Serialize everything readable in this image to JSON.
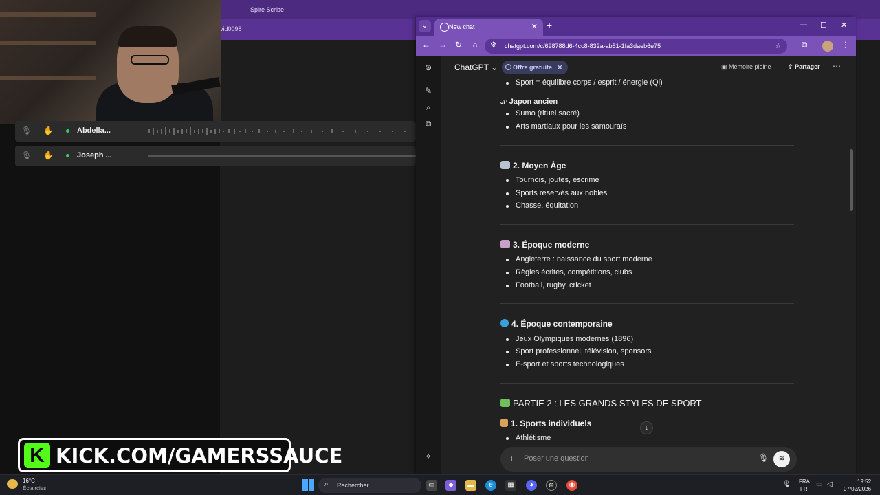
{
  "background_app": {
    "tab_title": "Spire Scribe",
    "url_fragment": "vid0098"
  },
  "voice_chat": {
    "participants": [
      {
        "name": "Abdella..."
      },
      {
        "name": "Joseph ..."
      }
    ]
  },
  "overlay": {
    "kick_logo": "K",
    "kick_text": "KICK.COM/GAMERSSAUCE"
  },
  "browser": {
    "tab_title": "New chat",
    "url": "chatgpt.com/c/698788d6-4cc8-832a-ab51-1fa3daeb6e75"
  },
  "chatgpt": {
    "model": "ChatGPT",
    "offer": "Offre gratuite",
    "memory": "Mémoire pleine",
    "share": "Partager",
    "composer_placeholder": "Poser une question"
  },
  "conversation": {
    "top_bullet": "Sport = équilibre corps / esprit / énergie (Qi)",
    "japan": {
      "flag": "JP",
      "title": "Japon ancien",
      "items": [
        "Sumo (rituel sacré)",
        "Arts martiaux pour les samouraïs"
      ]
    },
    "sections": [
      {
        "title": "2. Moyen Âge",
        "icon": "crossed-swords-icon",
        "color": "#b8c2d0",
        "items": [
          "Tournois, joutes, escrime",
          "Sports réservés aux nobles",
          "Chasse, équitation"
        ]
      },
      {
        "title": "3. Époque moderne",
        "icon": "stadium-icon",
        "color": "#c8a0c8",
        "items": [
          "Angleterre : naissance du sport moderne",
          "Règles écrites, compétitions, clubs",
          "Football, rugby, cricket"
        ]
      },
      {
        "title": "4. Époque contemporaine",
        "icon": "globe-icon",
        "color": "#3aa0d8",
        "items": [
          "Jeux Olympiques modernes (1896)",
          "Sport professionnel, télévision, sponsors",
          "E-sport et sports technologiques"
        ]
      }
    ],
    "part2": {
      "title": "PARTIE 2 : LES GRANDS STYLES DE SPORT",
      "icon": "puzzle-icon",
      "sub": "1. Sports individuels",
      "items": [
        "Athlétisme"
      ]
    }
  },
  "taskbar": {
    "temperature": "16°C",
    "condition": "Éclaircies",
    "search": "Rechercher",
    "lang": "FRA",
    "region": "FR",
    "time": "19:52",
    "date": "07/02/2026"
  }
}
